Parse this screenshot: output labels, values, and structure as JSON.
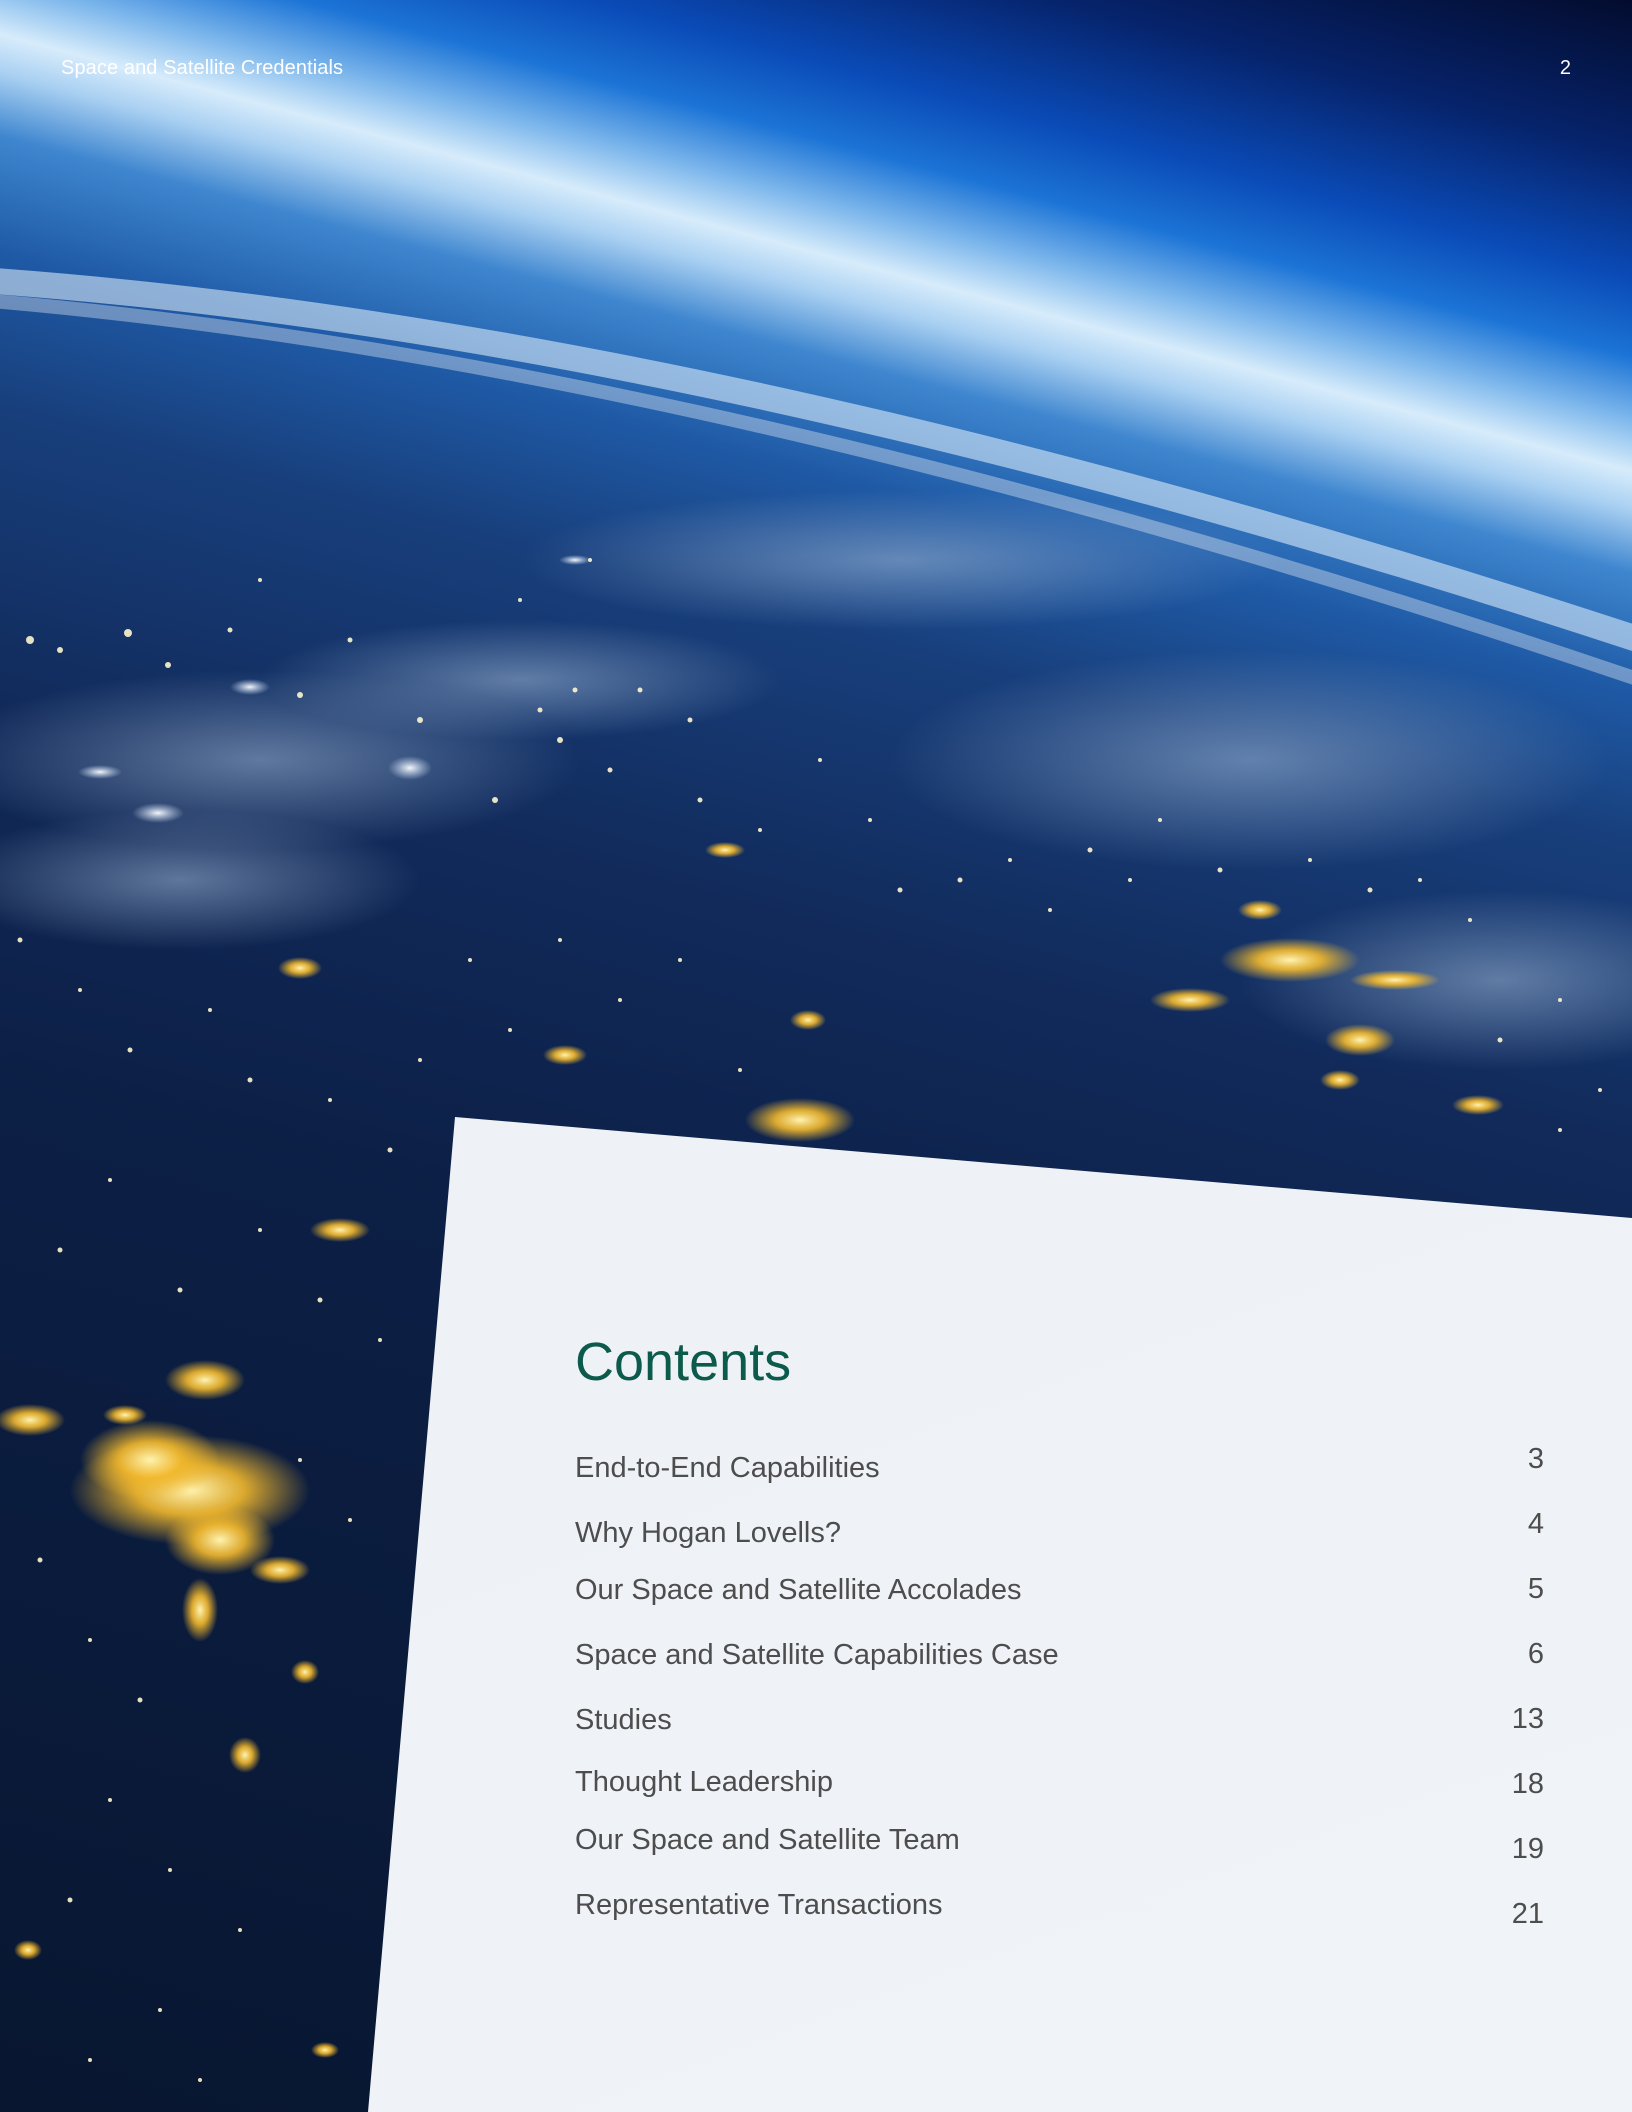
{
  "header": {
    "title": "Space and Satellite Credentials",
    "page_number": "2"
  },
  "contents": {
    "heading": "Contents",
    "entries": [
      {
        "label": "End-to-End Capabilities",
        "page": "3"
      },
      {
        "label": "Why Hogan Lovells?",
        "page": "4"
      },
      {
        "label": "Our Space and Satellite Accolades",
        "page": "5"
      },
      {
        "label": "Space and Satellite Capabilities Case",
        "page": "6"
      },
      {
        "label": "Studies",
        "page": "13"
      },
      {
        "label": "Thought Leadership",
        "page": "18"
      },
      {
        "label": "Our Space and Satellite Team",
        "page": "19"
      },
      {
        "label": "Representative Transactions",
        "page": "21"
      }
    ]
  },
  "colors": {
    "heading_green": "#0c5a4b",
    "body_text_gray": "#4d4d4d",
    "panel_background": "#eef2f6",
    "space_dark": "#030c2e",
    "atmosphere_blue": "#1c74d6",
    "city_lights_gold": "#f3b92c"
  }
}
